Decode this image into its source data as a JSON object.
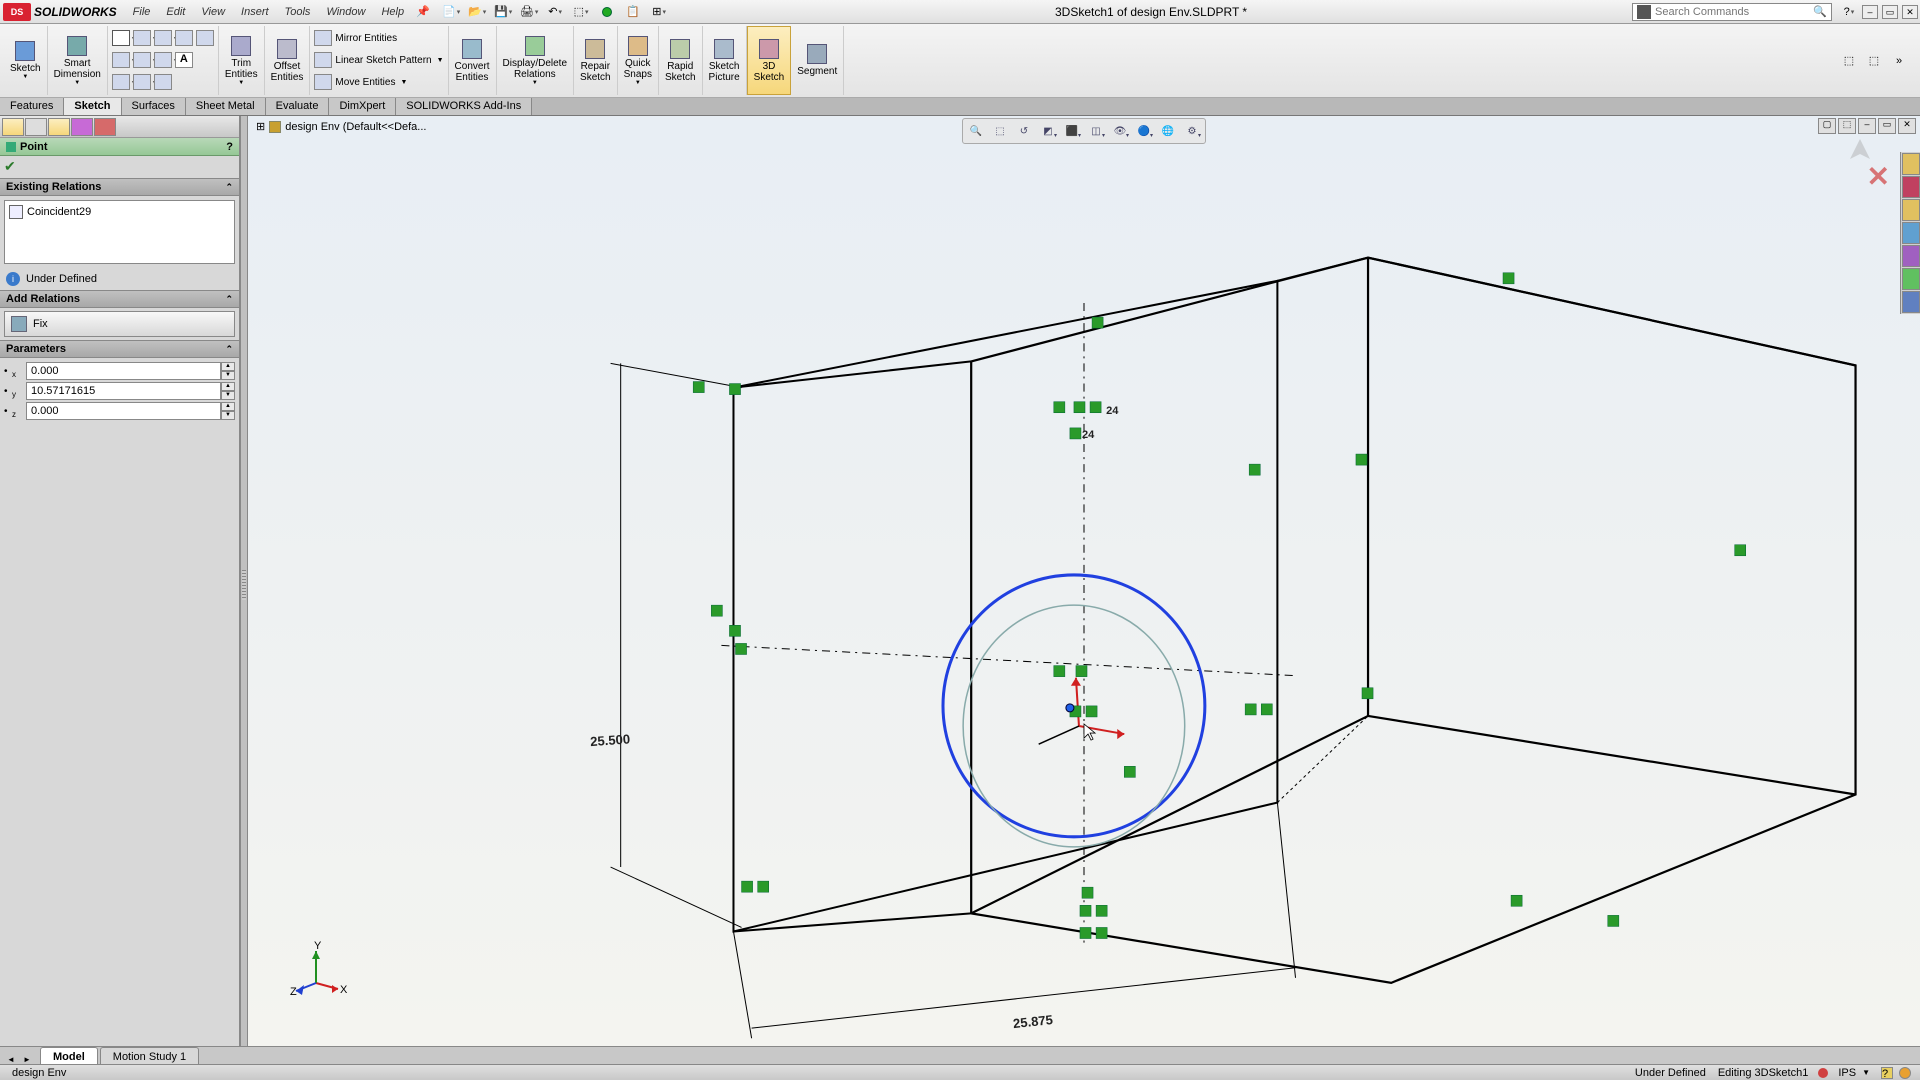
{
  "app": {
    "name": "SOLIDWORKS",
    "title": "3DSketch1 of design Env.SLDPRT *"
  },
  "menu": [
    "File",
    "Edit",
    "View",
    "Insert",
    "Tools",
    "Window",
    "Help"
  ],
  "search": {
    "placeholder": "Search Commands"
  },
  "ribbon": {
    "sketch": "Sketch",
    "smart_dim": "Smart\nDimension",
    "trim": "Trim\nEntities",
    "convert": "Convert\nEntities",
    "offset": "Offset\nEntities",
    "mirror": "Mirror Entities",
    "pattern": "Linear Sketch Pattern",
    "move": "Move Entities",
    "display_del": "Display/Delete\nRelations",
    "repair": "Repair\nSketch",
    "quick": "Quick\nSnaps",
    "rapid": "Rapid\nSketch",
    "picture": "Sketch\nPicture",
    "sketch3d": "3D\nSketch",
    "segment": "Segment"
  },
  "cmdtabs": [
    "Features",
    "Sketch",
    "Surfaces",
    "Sheet Metal",
    "Evaluate",
    "DimXpert",
    "SOLIDWORKS Add-Ins"
  ],
  "cmdtab_active": 1,
  "breadcrumb": "design Env  (Default<<Defa...",
  "pm": {
    "title": "Point",
    "section_existing": "Existing Relations",
    "rel0": "Coincident29",
    "status": "Under Defined",
    "section_add": "Add Relations",
    "fix": "Fix",
    "section_params": "Parameters",
    "px": "0.000",
    "py": "10.57171615",
    "pz": "0.000"
  },
  "dims": {
    "height": "25.500",
    "width": "25.875",
    "d24a": "24",
    "d24b": "24"
  },
  "bottom_tabs": [
    "Model",
    "Motion Study 1"
  ],
  "status": {
    "doc": "design Env",
    "def": "Under Defined",
    "edit": "Editing 3DSketch1",
    "units": "IPS"
  }
}
